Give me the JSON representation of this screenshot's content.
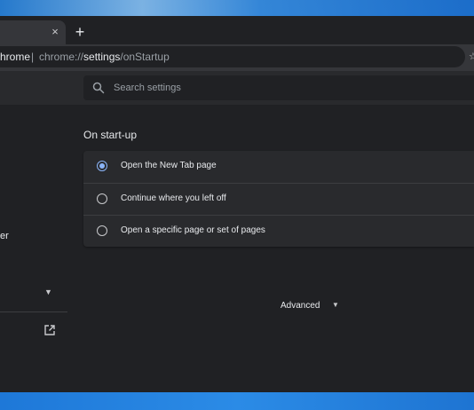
{
  "browser": {
    "tab_close_glyph": "×",
    "new_tab_glyph": "+",
    "site_name": "hrome",
    "url_separator": "|",
    "url_scheme": "chrome://",
    "url_host": "settings",
    "url_path": "/onStartup"
  },
  "search": {
    "placeholder": "Search settings"
  },
  "sidebar": {
    "partial_item_label": "er"
  },
  "startup": {
    "title": "On start-up",
    "options": [
      {
        "label": "Open the New Tab page",
        "selected": true
      },
      {
        "label": "Continue where you left off",
        "selected": false
      },
      {
        "label": "Open a specific page or set of pages",
        "selected": false
      }
    ]
  },
  "advanced": {
    "label": "Advanced"
  },
  "colors": {
    "accent": "#8ab4f8",
    "background": "#202124",
    "card": "#292a2d",
    "text": "#e8eaed"
  },
  "icons": {
    "search": "search-icon",
    "external_link": "open-in-new-icon",
    "chevron": "chevron-down-icon"
  }
}
